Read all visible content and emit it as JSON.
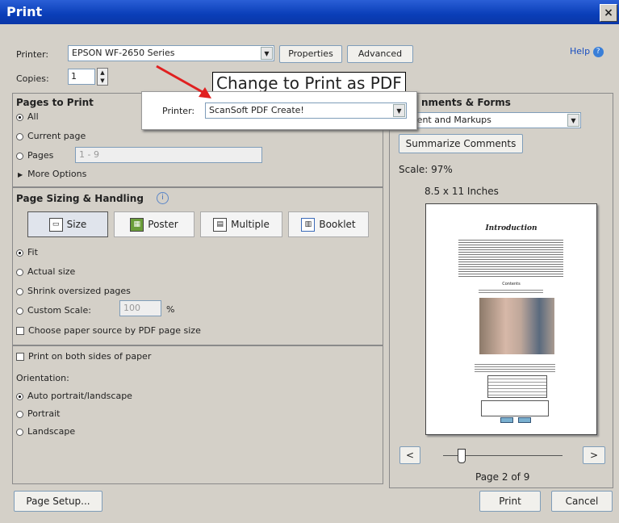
{
  "window": {
    "title": "Print",
    "close": "×"
  },
  "printer": {
    "label": "Printer:",
    "value": "EPSON WF-2650 Series",
    "properties": "Properties",
    "advanced": "Advanced"
  },
  "copies": {
    "label": "Copies:",
    "value": "1"
  },
  "help": "Help",
  "pages": {
    "title": "Pages to Print",
    "all": "All",
    "current": "Current page",
    "pages": "Pages",
    "pages_placeholder": "1 - 9",
    "more": "More Options"
  },
  "sizing": {
    "title": "Page Sizing & Handling",
    "size": "Size",
    "poster": "Poster",
    "multiple": "Multiple",
    "booklet": "Booklet",
    "fit": "Fit",
    "actual": "Actual size",
    "shrink": "Shrink oversized pages",
    "custom": "Custom Scale:",
    "custom_value": "100",
    "percent": "%",
    "paper_source": "Choose paper source by PDF page size"
  },
  "duplex": "Print on both sides of paper",
  "orientation": {
    "title": "Orientation:",
    "auto": "Auto portrait/landscape",
    "portrait": "Portrait",
    "landscape": "Landscape"
  },
  "comments": {
    "title": "nments & Forms",
    "value": "ument and Markups",
    "summarize": "Summarize Comments"
  },
  "preview": {
    "scale": "Scale:  97%",
    "paper": "8.5 x 11 Inches",
    "page_label": "Page 2 of 9",
    "doc_heading": "Introduction",
    "doc_contents": "Contents",
    "slider_fraction": 0.15
  },
  "footer": {
    "page_setup": "Page Setup...",
    "print": "Print",
    "cancel": "Cancel"
  },
  "callout": {
    "label": "Change to Print as PDF",
    "printer_label": "Printer:",
    "printer_value": "ScanSoft PDF Create!"
  }
}
